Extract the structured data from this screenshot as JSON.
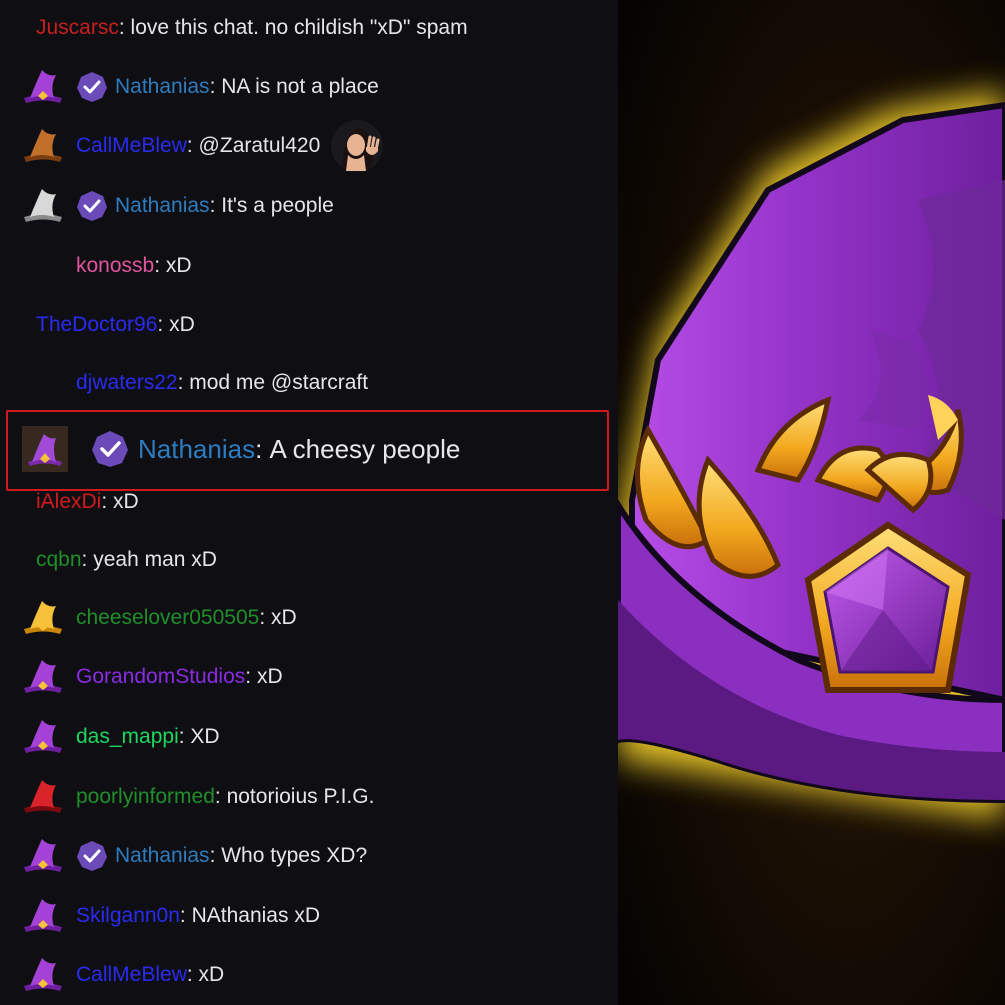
{
  "chat": {
    "messages": [
      {
        "user": "Juscarsc",
        "color": "#c81e1e",
        "text": "love this chat. no childish \"xD\" spam",
        "hat": "",
        "verified": false,
        "indent": 36
      },
      {
        "user": "Nathanias",
        "color": "#2e7cc0",
        "text": "NA is not a place",
        "hat": "purple",
        "verified": true,
        "indent": 22
      },
      {
        "user": "CallMeBlew",
        "color": "#2a2af0",
        "text": "@Zaratul420",
        "hat": "brown",
        "verified": false,
        "indent": 22,
        "emote": "wave-emote"
      },
      {
        "user": "Nathanias",
        "color": "#2e7cc0",
        "text": "It's a people",
        "hat": "white",
        "verified": true,
        "indent": 22
      },
      {
        "user": "konossb",
        "color": "#e0559e",
        "text": "xD",
        "hat": "",
        "verified": false,
        "indent": 76
      },
      {
        "user": "TheDoctor96",
        "color": "#2a2af0",
        "text": "xD",
        "hat": "",
        "verified": false,
        "indent": 36
      },
      {
        "user": "djwaters22",
        "color": "#2a2af0",
        "text": "mod me @starcraft",
        "hat": "",
        "verified": false,
        "indent": 76
      },
      {
        "user": "iAlexDi",
        "color": "#d01a1f",
        "text": "xD",
        "hat": "",
        "verified": false,
        "indent": 36
      },
      {
        "user": "cqbn",
        "color": "#1f8f2a",
        "text": "yeah man xD",
        "hat": "",
        "verified": false,
        "indent": 36
      },
      {
        "user": "cheeselover050505",
        "color": "#1f8f2a",
        "text": "xD",
        "hat": "gold",
        "verified": false,
        "indent": 22
      },
      {
        "user": "GorandomStudios",
        "color": "#8a2be2",
        "text": "xD",
        "hat": "purple",
        "verified": false,
        "indent": 22
      },
      {
        "user": "das_mappi",
        "color": "#1ed760",
        "text": "XD",
        "hat": "purple",
        "verified": false,
        "indent": 22
      },
      {
        "user": "poorlyinformed",
        "color": "#1f8f2a",
        "text": "notorioius P.I.G.",
        "hat": "red",
        "verified": false,
        "indent": 22
      },
      {
        "user": "Nathanias",
        "color": "#2e7cc0",
        "text": "Who types XD?",
        "hat": "purple",
        "verified": true,
        "indent": 22
      },
      {
        "user": "Skilgann0n",
        "color": "#2a2af0",
        "text": "NAthanias xD",
        "hat": "purple",
        "verified": false,
        "indent": 22
      },
      {
        "user": "CallMeBlew",
        "color": "#2a2af0",
        "text": "xD",
        "hat": "purple",
        "verified": false,
        "indent": 22
      }
    ],
    "highlight": {
      "user": "Nathanias",
      "color": "#2e7cc0",
      "text": "A cheesy people",
      "hat": "purple",
      "verified": true,
      "border_color": "#d01a1f"
    }
  },
  "colors": {
    "background": "#0f0f13",
    "hat_purple": "#9b3ac8",
    "hat_gold": "#f5c23a",
    "badge_purple": "#6b4bb8"
  },
  "icons": {
    "verified": "verified-check-icon",
    "hat": "wizard-hat-icon",
    "emote": "wave-emote"
  }
}
